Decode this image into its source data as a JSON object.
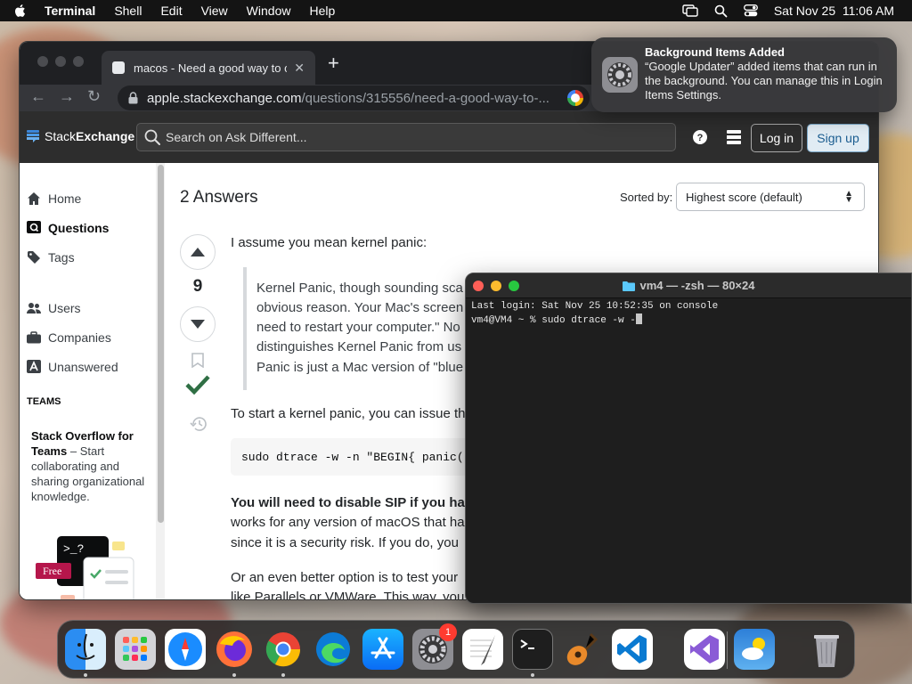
{
  "menubar": {
    "app_name": "Terminal",
    "menus": [
      "Shell",
      "Edit",
      "View",
      "Window",
      "Help"
    ],
    "datetime": "Sat Nov 25  11:06 AM"
  },
  "browser": {
    "tab_title": "macos - Need a good way to c",
    "url_host": "apple.stackexchange.com",
    "url_path": "/questions/315556/need-a-good-way-to-...",
    "se": {
      "logo_a": "Stack",
      "logo_b": "Exchange",
      "search_placeholder": "Search on Ask Different...",
      "login_label": "Log in",
      "signup_label": "Sign up"
    },
    "sidebar": {
      "items": [
        "Home",
        "Questions",
        "Tags",
        "Users",
        "Companies",
        "Unanswered"
      ],
      "teams_heading": "TEAMS",
      "teams_bold": "Stack Overflow for Teams",
      "teams_text": "– Start collaborating and sharing organizational knowledge.",
      "promo_badge": "Free",
      "promo_glyph": ">_?"
    },
    "content": {
      "answers_heading": "2 Answers",
      "sorted_by_label": "Sorted by:",
      "sort_value": "Highest score (default)",
      "vote_count": "9",
      "intro": "I assume you mean kernel panic:",
      "quote_lines": [
        "Kernel Panic, though sounding sca",
        "obvious reason. Your Mac's screen",
        "need to restart your computer.\" No",
        "distinguishes Kernel Panic from us",
        "Panic is just a Mac version of \"blue"
      ],
      "start_text": "To start a kernel panic, you can issue th",
      "code": "sudo dtrace -w -n \"BEGIN{ panic(",
      "sip_bold": "You will need to disable SIP if you ha",
      "sip_line2": "works for any version of macOS that ha",
      "sip_line3": "since it is a security risk. If you do, you",
      "better_line1": "Or an even better option is to test your",
      "better_line2": "like Parallels or VMWare. This way, you"
    }
  },
  "notification": {
    "title": "Background Items Added",
    "message": "“Google Updater” added items that can run in the background. You can manage this in Login Items Settings."
  },
  "terminal": {
    "title": "vm4 — -zsh — 80×24",
    "line1": "Last login: Sat Nov 25 10:52:35 on console",
    "line2": "vm4@VM4 ~ % sudo dtrace -w -"
  },
  "dock": {
    "apps": [
      "Finder",
      "Launchpad",
      "Safari",
      "Firefox",
      "Chrome",
      "Edge",
      "App Store",
      "System Settings",
      "TextEdit",
      "Terminal",
      "GarageBand",
      "Visual Studio Code",
      "Visual Studio",
      "Weather",
      "Trash"
    ],
    "settings_badge": "1"
  },
  "colors": {
    "accent_blue": "#0a95ff",
    "accepted_green": "#2f6f44",
    "traffic_red": "#ff5f57",
    "traffic_yellow": "#febc2e",
    "traffic_green": "#28c840"
  }
}
